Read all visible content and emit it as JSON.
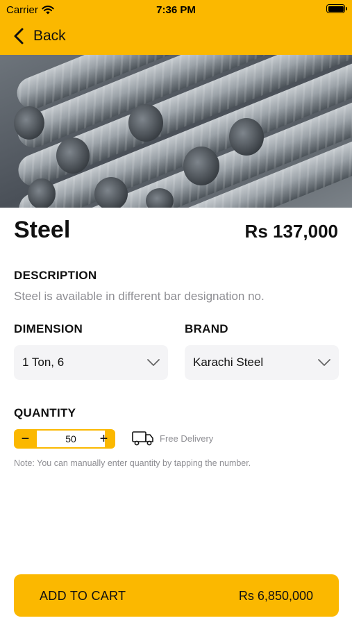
{
  "status_bar": {
    "carrier": "Carrier",
    "time": "7:36 PM"
  },
  "nav": {
    "back_label": "Back"
  },
  "product": {
    "name": "Steel",
    "price": "Rs 137,000",
    "image_icon": "steel-rebar-photo"
  },
  "description": {
    "label": "DESCRIPTION",
    "text": "Steel is available in different bar designation no."
  },
  "dimension": {
    "label": "DIMENSION",
    "value": "1 Ton, 6"
  },
  "brand": {
    "label": "BRAND",
    "value": "Karachi Steel"
  },
  "quantity": {
    "label": "QUANTITY",
    "minus": "−",
    "plus": "+",
    "value": "50",
    "delivery_text": "Free Delivery",
    "note": "Note: You can manually enter quantity by tapping the number."
  },
  "cart": {
    "label": "ADD TO CART",
    "total": "Rs 6,850,000"
  },
  "colors": {
    "accent": "#fbb800",
    "muted": "#8e8e93",
    "field_bg": "#f4f4f6"
  }
}
